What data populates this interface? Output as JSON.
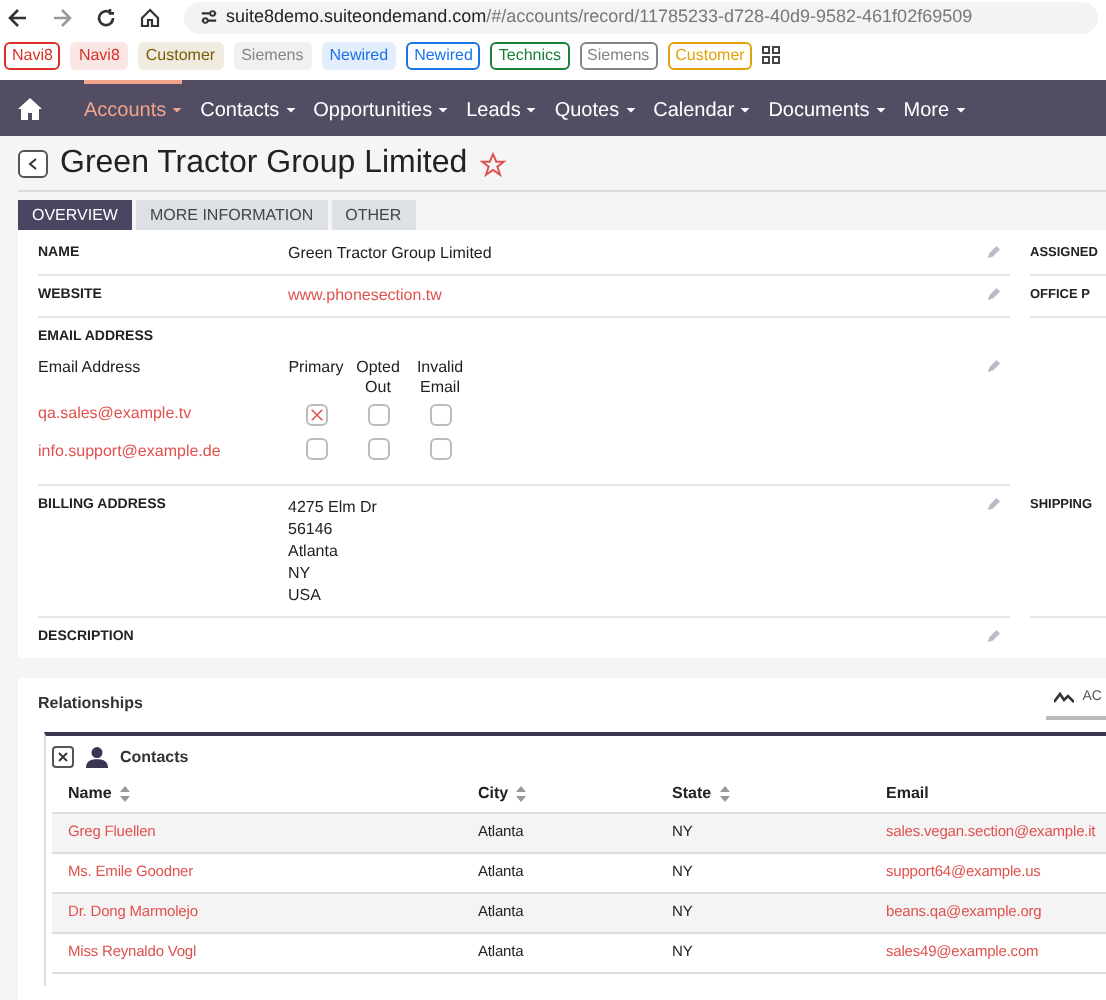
{
  "browser": {
    "url_host": "suite8demo.suiteondemand.com",
    "url_path": "/#/accounts/record/11785233-d728-40d9-9582-461f02f69509"
  },
  "bookmarks": [
    {
      "label": "Navi8",
      "color": "#d93025",
      "kind": "outline"
    },
    {
      "label": "Navi8",
      "color": "#d93025",
      "kind": "filled"
    },
    {
      "label": "Customer",
      "color": "#7a5c00",
      "kind": "filled"
    },
    {
      "label": "Siemens",
      "color": "#80868b",
      "kind": "filled"
    },
    {
      "label": "Newired",
      "color": "#1a73e8",
      "kind": "filled"
    },
    {
      "label": "Newired",
      "color": "#1a73e8",
      "kind": "outline"
    },
    {
      "label": "Technics",
      "color": "#188038",
      "kind": "outline"
    },
    {
      "label": "Siemens",
      "color": "#80868b",
      "kind": "outline"
    },
    {
      "label": "Customer",
      "color": "#e3a008",
      "kind": "outline"
    }
  ],
  "nav": [
    {
      "label": "Accounts",
      "selected": true
    },
    {
      "label": "Contacts",
      "selected": false
    },
    {
      "label": "Opportunities",
      "selected": false
    },
    {
      "label": "Leads",
      "selected": false
    },
    {
      "label": "Quotes",
      "selected": false
    },
    {
      "label": "Calendar",
      "selected": false
    },
    {
      "label": "Documents",
      "selected": false
    },
    {
      "label": "More",
      "selected": false
    }
  ],
  "record": {
    "title": "Green Tractor Group Limited",
    "favorite": false
  },
  "tabs": [
    {
      "label": "OVERVIEW",
      "selected": true
    },
    {
      "label": "MORE INFORMATION",
      "selected": false
    },
    {
      "label": "OTHER",
      "selected": false
    }
  ],
  "fields": [
    {
      "kind": "text",
      "label": "NAME",
      "value": "Green Tractor Group Limited",
      "right_label": "ASSIGNED"
    },
    {
      "kind": "link",
      "label": "WEBSITE",
      "value": "www.phonesection.tw",
      "right_label": "OFFICE P"
    },
    {
      "kind": "email",
      "label": "EMAIL ADDRESS",
      "columns": [
        "Email Address",
        "Primary",
        "Opted Out",
        "Invalid Email"
      ],
      "emails": [
        {
          "address": "qa.sales@example.tv",
          "primary": true,
          "opted_out": false,
          "invalid": false
        },
        {
          "address": "info.support@example.de",
          "primary": false,
          "opted_out": false,
          "invalid": false
        }
      ]
    },
    {
      "kind": "address",
      "label": "BILLING ADDRESS",
      "lines": [
        "4275 Elm Dr",
        "56146",
        "Atlanta",
        "NY",
        "USA"
      ],
      "right_label": "SHIPPING"
    },
    {
      "kind": "text",
      "label": "DESCRIPTION"
    }
  ],
  "relationships": {
    "title": "Relationships",
    "action": "AC",
    "subpanel": {
      "title": "Contacts",
      "columns": [
        {
          "label": "Name",
          "sortable": true
        },
        {
          "label": "City",
          "sortable": true
        },
        {
          "label": "State",
          "sortable": true
        },
        {
          "label": "Email",
          "sortable": false
        }
      ],
      "rows": [
        [
          "Greg Fluellen",
          "Atlanta",
          "NY",
          "sales.vegan.section@example.it"
        ],
        [
          "Ms. Emile Goodner",
          "Atlanta",
          "NY",
          "support64@example.us"
        ],
        [
          "Dr. Dong Marmolejo",
          "Atlanta",
          "NY",
          "beans.qa@example.org"
        ],
        [
          "Miss Reynaldo Vogl",
          "Atlanta",
          "NY",
          "sales49@example.com"
        ]
      ]
    }
  }
}
